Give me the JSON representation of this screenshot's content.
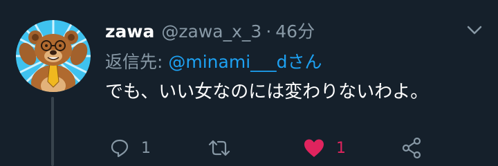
{
  "tweet": {
    "display_name": "zawa",
    "handle": "@zawa_x_3",
    "separator": "·",
    "time": "46分",
    "reply_prefix": "返信先: ",
    "reply_mention": "@minami___d",
    "reply_suffix": "さん",
    "text": "でも、いい女なのには変わりないわよ。",
    "avatar_icon": "bear-avatar"
  },
  "actions": {
    "reply_count": "1",
    "retweet_count": "",
    "like_count": "1",
    "liked": true
  },
  "colors": {
    "background": "#15202b",
    "secondary_text": "#8899a6",
    "link": "#1da1f2",
    "like": "#e0245e"
  }
}
